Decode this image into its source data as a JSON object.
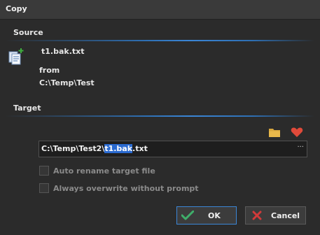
{
  "window": {
    "title": "Copy"
  },
  "source": {
    "label": "Source",
    "file_name": "t1.bak.txt",
    "from_label": "from",
    "path": "C:\\Temp\\Test",
    "icon": "copy-files-icon"
  },
  "target": {
    "label": "Target",
    "path_prefix": "C:\\Temp\\Test2\\",
    "path_selected": "t1.bak",
    "path_suffix": ".txt",
    "browse_icon": "folder-icon",
    "favorite_icon": "heart-icon",
    "ellipsis_label": "···"
  },
  "options": {
    "auto_rename_label": "Auto rename target file",
    "auto_rename_checked": false,
    "always_overwrite_label": "Always overwrite without prompt",
    "always_overwrite_checked": false
  },
  "buttons": {
    "ok_label": "OK",
    "cancel_label": "Cancel"
  },
  "colors": {
    "accent": "#3b86d6",
    "ok_check": "#3fae6a",
    "cancel_x": "#d23a3a",
    "favorite": "#e04a3a",
    "folder": "#d9a83e"
  }
}
